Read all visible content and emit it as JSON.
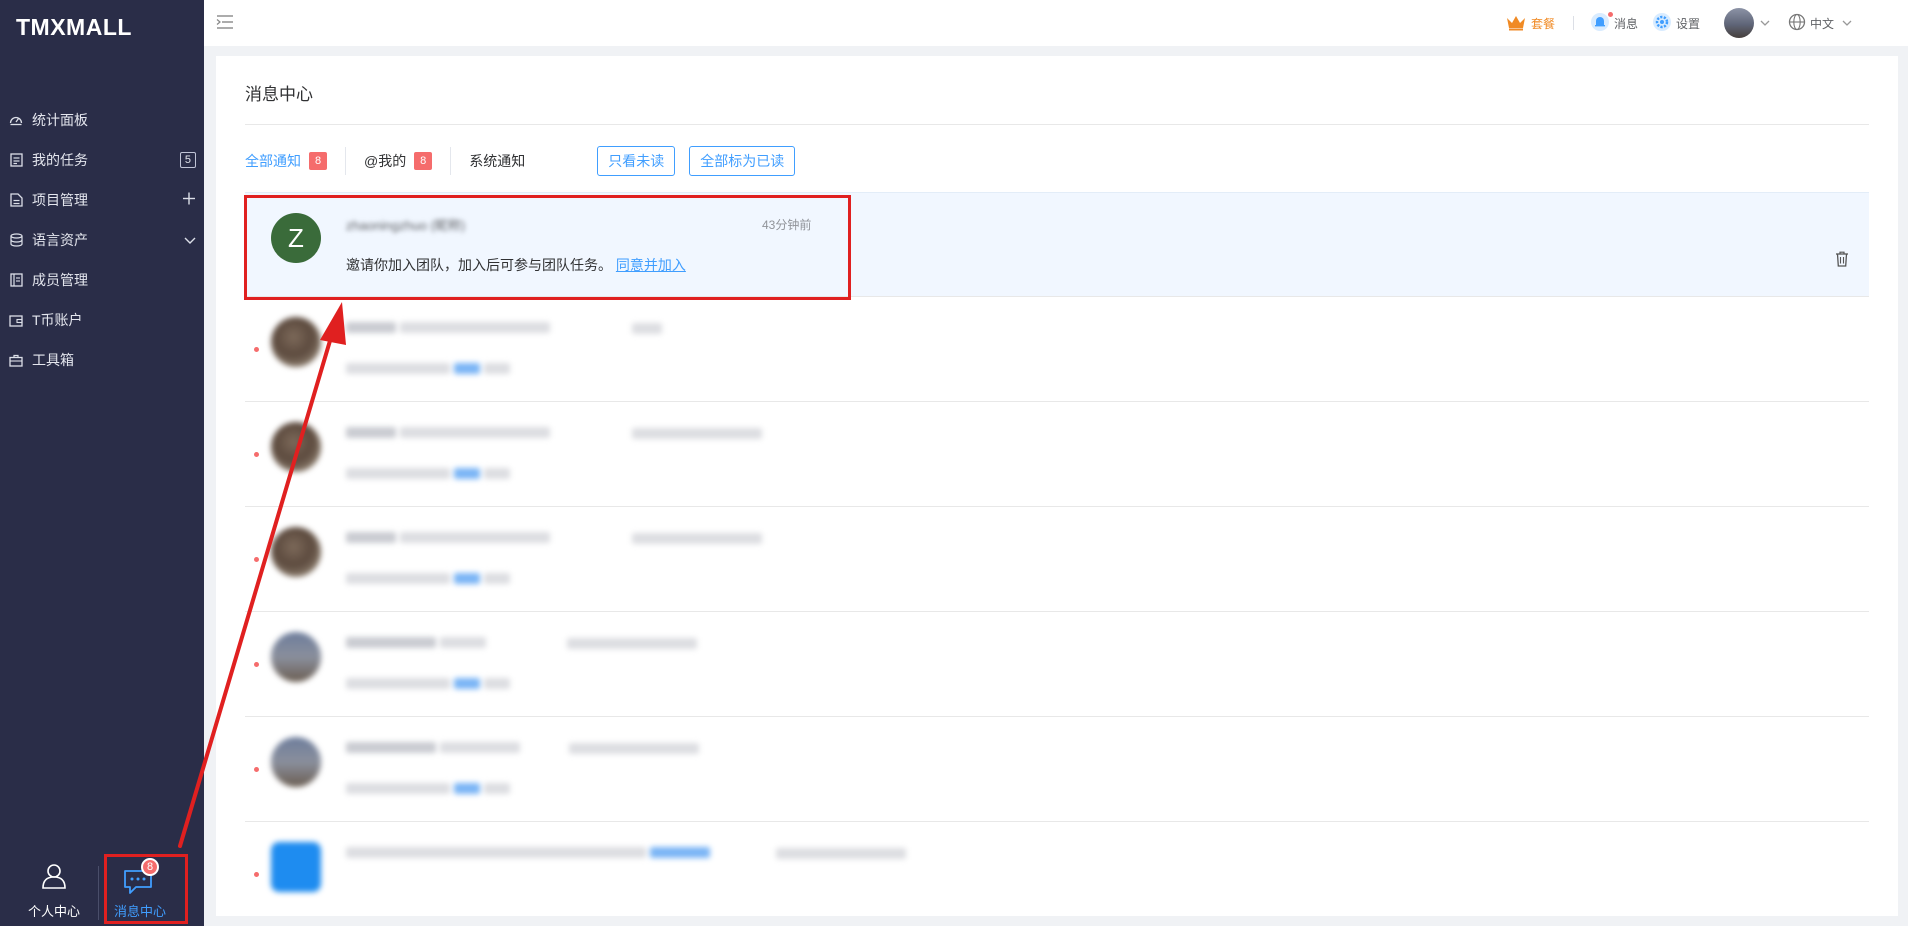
{
  "app": {
    "logo": "TMXMALL"
  },
  "sidebar": {
    "items": [
      {
        "label": "统计面板",
        "icon": "dashboard-icon"
      },
      {
        "label": "我的任务",
        "icon": "task-icon",
        "badge": "5"
      },
      {
        "label": "项目管理",
        "icon": "project-icon",
        "right_icon": "plus-icon"
      },
      {
        "label": "语言资产",
        "icon": "database-icon",
        "right_icon": "chevron-down-icon"
      },
      {
        "label": "成员管理",
        "icon": "member-icon"
      },
      {
        "label": "T币账户",
        "icon": "wallet-icon"
      },
      {
        "label": "工具箱",
        "icon": "toolbox-icon"
      }
    ],
    "bottom": {
      "personal": {
        "label": "个人中心",
        "icon": "user-icon"
      },
      "messages": {
        "label": "消息中心",
        "icon": "chat-icon",
        "badge": "8"
      }
    }
  },
  "header": {
    "plan": {
      "label": "套餐",
      "icon": "crown-icon"
    },
    "messages": {
      "label": "消息",
      "icon": "bell-icon"
    },
    "settings": {
      "label": "设置",
      "icon": "gear-icon"
    },
    "language": {
      "label": "中文",
      "icon": "globe-icon"
    }
  },
  "main": {
    "title": "消息中心",
    "tabs": [
      {
        "label": "全部通知",
        "badge": "8"
      },
      {
        "label": "@我的",
        "badge": "8"
      },
      {
        "label": "系统通知"
      }
    ],
    "actions": {
      "unread_only": "只看未读",
      "mark_all_read": "全部标为已读"
    },
    "messages": [
      {
        "sender": "zhaoningzhuo (昵称)",
        "time": "43分钟前",
        "text": "邀请你加入团队，加入后可参与团队任务。",
        "link": "同意并加入"
      }
    ]
  },
  "colors": {
    "sidebar_bg": "#2a2d48",
    "accent": "#409eff",
    "badge_red": "#f56c6c",
    "annotation_red": "#e02020",
    "plan_orange": "#f08a24"
  }
}
